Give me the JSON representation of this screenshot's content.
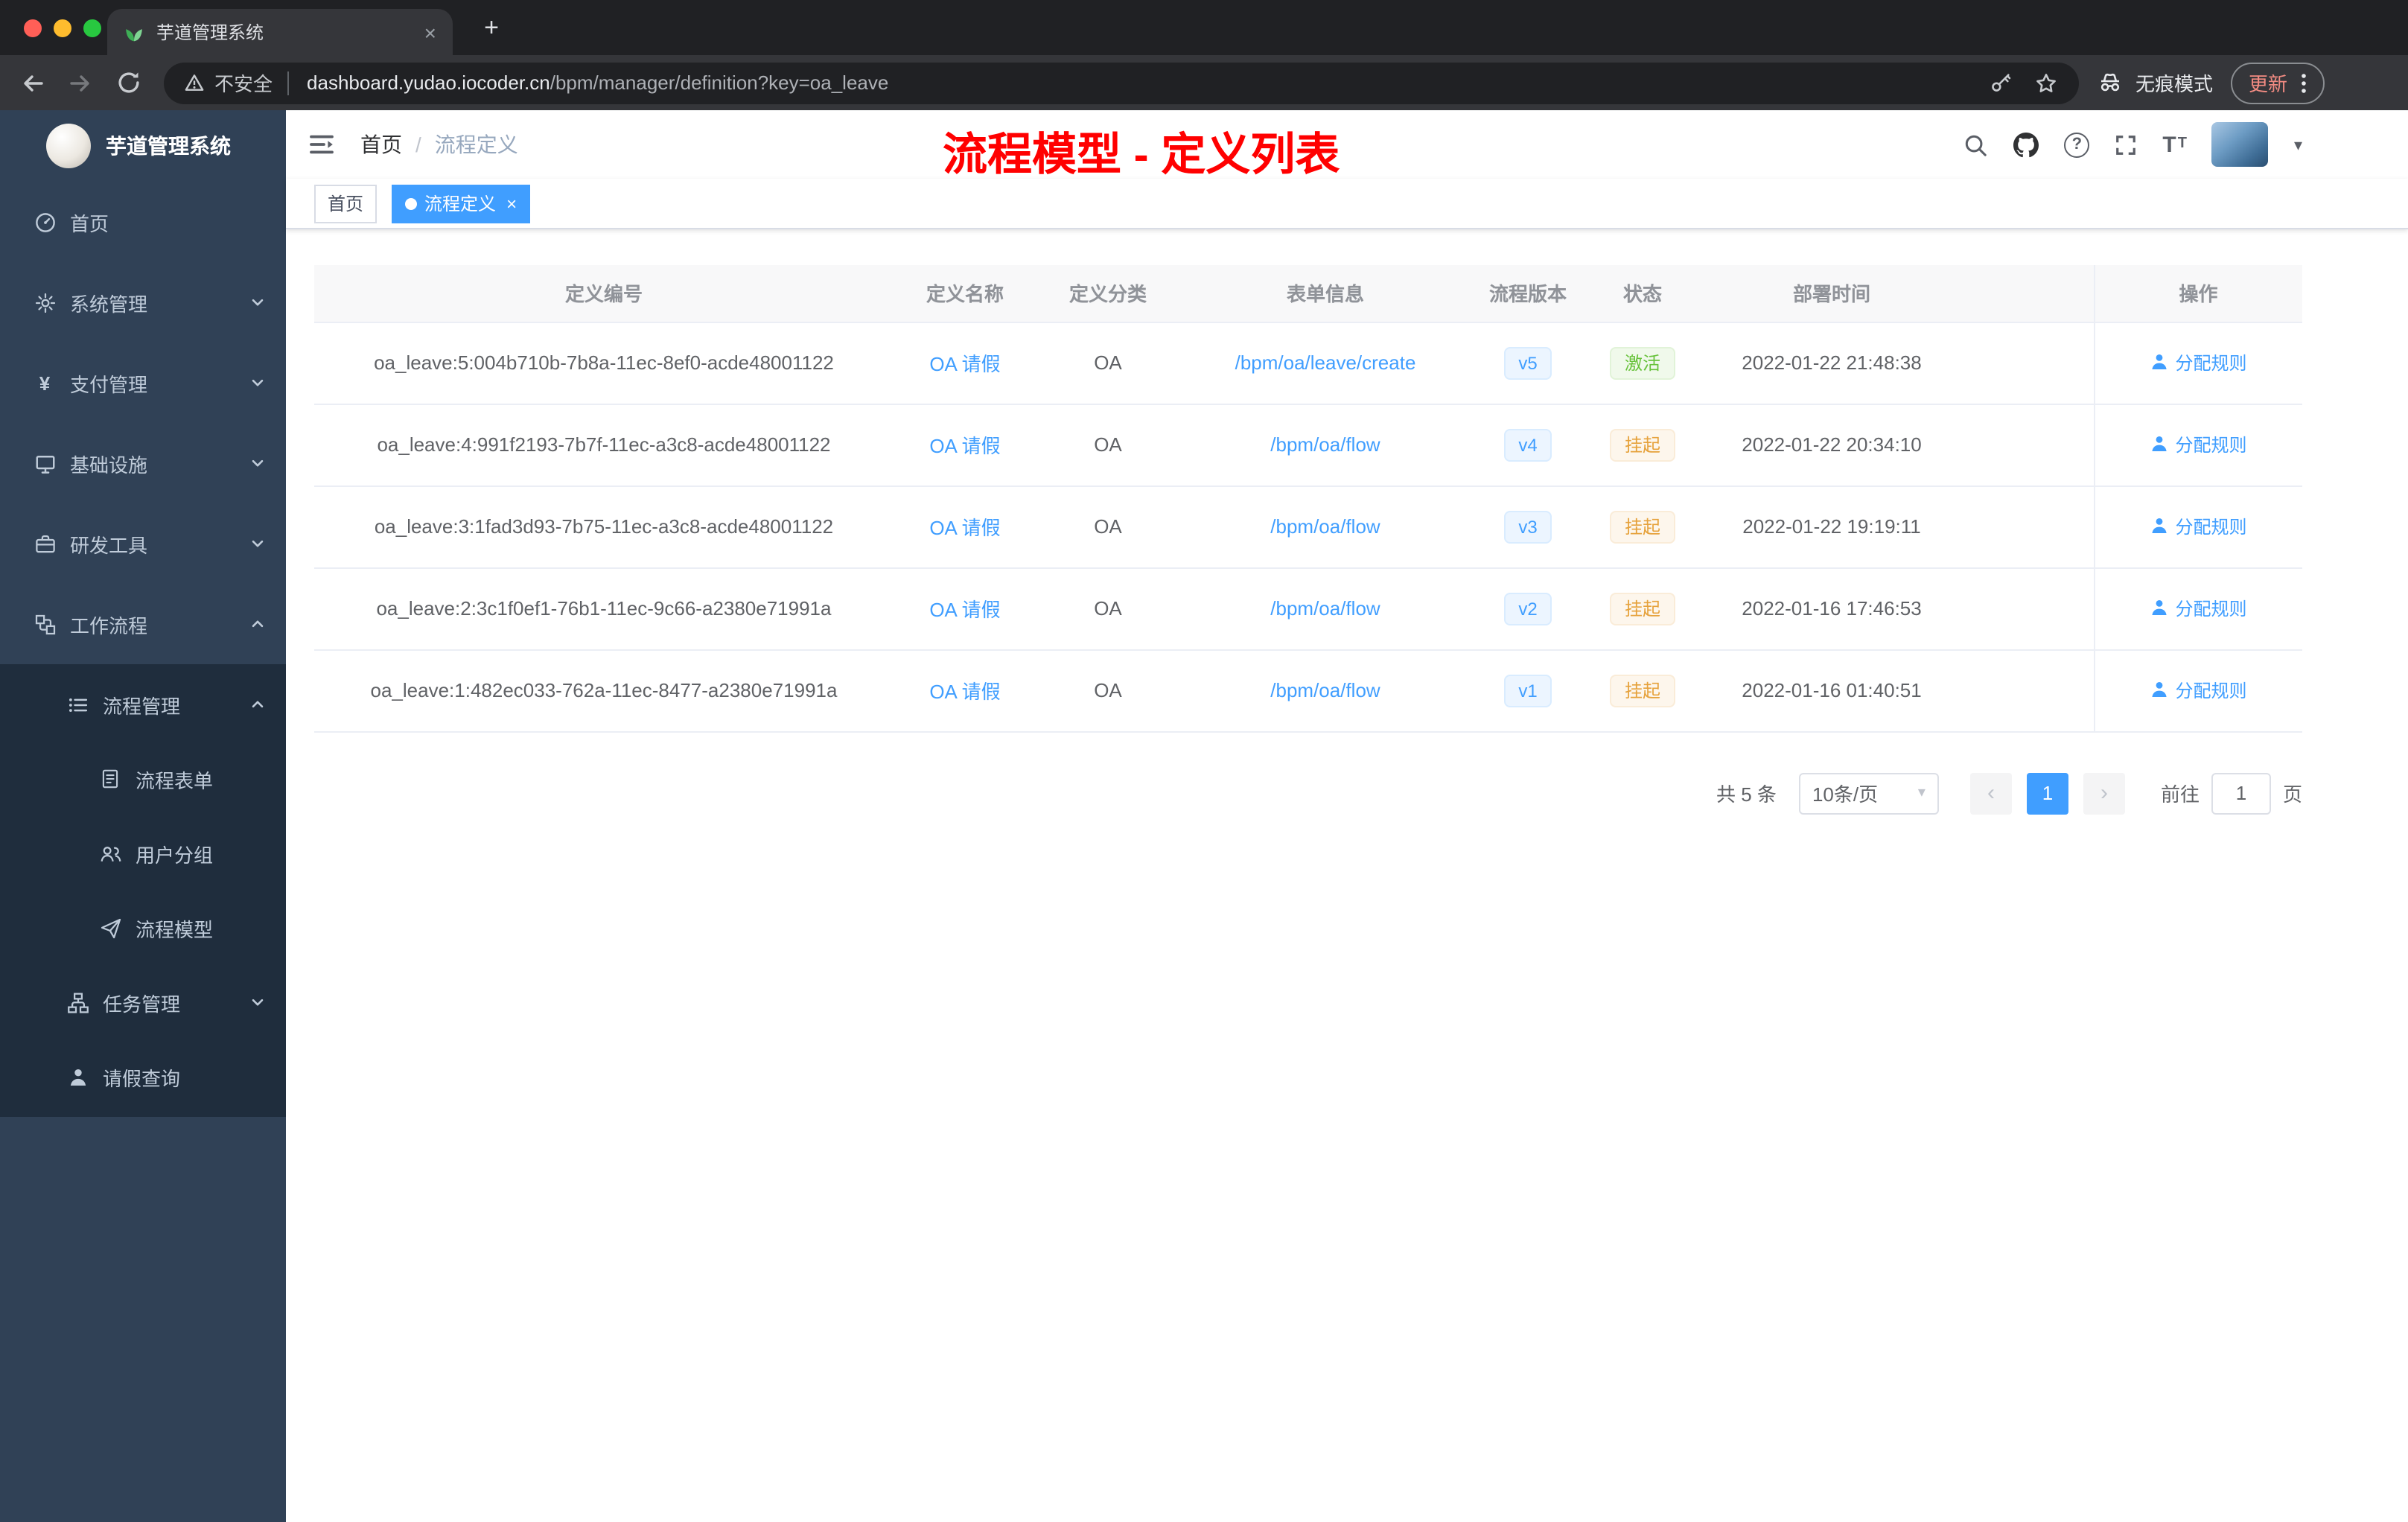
{
  "browser": {
    "tab_title": "芋道管理系统",
    "security_label": "不安全",
    "url_domain": "dashboard.yudao.iocoder.cn",
    "url_path": "/bpm/manager/definition?key=oa_leave",
    "incognito_label": "无痕模式",
    "update_label": "更新"
  },
  "glyphs": {
    "plus": "+",
    "close": "×",
    "yen": "¥",
    "question": "?",
    "font_letter": "T",
    "caret_down": "▾",
    "prev": "‹",
    "next": "›",
    "breadcrumb_sep": "/"
  },
  "sidebar": {
    "logo_title": "芋道管理系统",
    "items": [
      {
        "label": "首页",
        "icon": "dashboard-icon"
      },
      {
        "label": "系统管理",
        "icon": "gear-icon",
        "chevron": "down"
      },
      {
        "label": "支付管理",
        "icon": "yen-icon",
        "chevron": "down"
      },
      {
        "label": "基础设施",
        "icon": "infrastructure-icon",
        "chevron": "down"
      },
      {
        "label": "研发工具",
        "icon": "tools-icon",
        "chevron": "down"
      },
      {
        "label": "工作流程",
        "icon": "workflow-icon",
        "chevron": "up",
        "children": [
          {
            "label": "流程管理",
            "icon": "process-list-icon",
            "chevron": "up",
            "children": [
              {
                "label": "流程表单",
                "icon": "form-icon"
              },
              {
                "label": "用户分组",
                "icon": "user-group-icon"
              },
              {
                "label": "流程模型",
                "icon": "paper-plane-icon"
              }
            ]
          },
          {
            "label": "任务管理",
            "icon": "task-tree-icon",
            "chevron": "down"
          },
          {
            "label": "请假查询",
            "icon": "person-icon"
          }
        ]
      }
    ]
  },
  "navbar": {
    "breadcrumb": [
      "首页",
      "流程定义"
    ],
    "annotation": "流程模型 - 定义列表",
    "icons": [
      "search-icon",
      "github-icon",
      "question-icon",
      "fullscreen-icon",
      "font-size-icon"
    ]
  },
  "tags": {
    "items": [
      {
        "label": "首页",
        "active": false
      },
      {
        "label": "流程定义",
        "active": true
      }
    ]
  },
  "table": {
    "columns": [
      "定义编号",
      "定义名称",
      "定义分类",
      "表单信息",
      "流程版本",
      "状态",
      "部署时间",
      "操作"
    ],
    "rows": [
      {
        "id": "oa_leave:5:004b710b-7b8a-11ec-8ef0-acde48001122",
        "name": "OA 请假",
        "category": "OA",
        "form": "/bpm/oa/leave/create",
        "version": "v5",
        "status": {
          "label": "激活",
          "type": "success"
        },
        "time": "2022-01-22 21:48:38",
        "action": "分配规则"
      },
      {
        "id": "oa_leave:4:991f2193-7b7f-11ec-a3c8-acde48001122",
        "name": "OA 请假",
        "category": "OA",
        "form": "/bpm/oa/flow",
        "version": "v4",
        "status": {
          "label": "挂起",
          "type": "warning"
        },
        "time": "2022-01-22 20:34:10",
        "action": "分配规则"
      },
      {
        "id": "oa_leave:3:1fad3d93-7b75-11ec-a3c8-acde48001122",
        "name": "OA 请假",
        "category": "OA",
        "form": "/bpm/oa/flow",
        "version": "v3",
        "status": {
          "label": "挂起",
          "type": "warning"
        },
        "time": "2022-01-22 19:19:11",
        "action": "分配规则"
      },
      {
        "id": "oa_leave:2:3c1f0ef1-76b1-11ec-9c66-a2380e71991a",
        "name": "OA 请假",
        "category": "OA",
        "form": "/bpm/oa/flow",
        "version": "v2",
        "status": {
          "label": "挂起",
          "type": "warning"
        },
        "time": "2022-01-16 17:46:53",
        "action": "分配规则"
      },
      {
        "id": "oa_leave:1:482ec033-762a-11ec-8477-a2380e71991a",
        "name": "OA 请假",
        "category": "OA",
        "form": "/bpm/oa/flow",
        "version": "v1",
        "status": {
          "label": "挂起",
          "type": "warning"
        },
        "time": "2022-01-16 01:40:51",
        "action": "分配规则"
      }
    ]
  },
  "pagination": {
    "total": "共 5 条",
    "page_size": "10条/页",
    "current_page": "1",
    "goto_label": "前往",
    "goto_value": "1",
    "page_unit": "页"
  },
  "colors": {
    "accent": "#409eff",
    "success": "#67c23a",
    "warning": "#e6a23c",
    "annotation_red": "#ff0000",
    "sidebar_bg": "#304156",
    "submenu_bg": "#1f2d3d"
  }
}
